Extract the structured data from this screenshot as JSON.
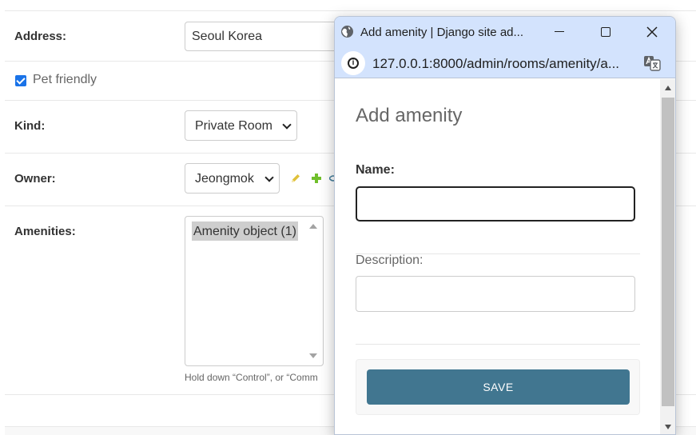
{
  "admin_form": {
    "address_label": "Address:",
    "address_value": "Seoul Korea",
    "pet_friendly_label": "Pet friendly",
    "pet_friendly_checked": true,
    "kind_label": "Kind:",
    "kind_value": "Private Room",
    "owner_label": "Owner:",
    "owner_value": "Jeongmok",
    "amenities_label": "Amenities:",
    "amenities_options": [
      "Amenity object (1)"
    ],
    "amenities_help": "Hold down “Control”, or “Comm"
  },
  "popup": {
    "window_title": "Add amenity | Django site ad...",
    "url": "127.0.0.1:8000/admin/rooms/amenity/a...",
    "heading": "Add amenity",
    "name_label": "Name:",
    "name_value": "",
    "description_label": "Description:",
    "description_value": "",
    "save_label": "SAVE"
  },
  "colors": {
    "save_button": "#417690",
    "titlebar": "#d3e3fd",
    "checkbox": "#1a73e8",
    "edit_icon": "#e0c13a",
    "add_icon": "#70bf2b"
  },
  "icons": [
    "globe-icon",
    "minimize-icon",
    "maximize-icon",
    "close-icon",
    "info-icon",
    "translate-icon",
    "pencil-icon",
    "plus-icon",
    "eye-icon",
    "chevron-down-icon"
  ]
}
